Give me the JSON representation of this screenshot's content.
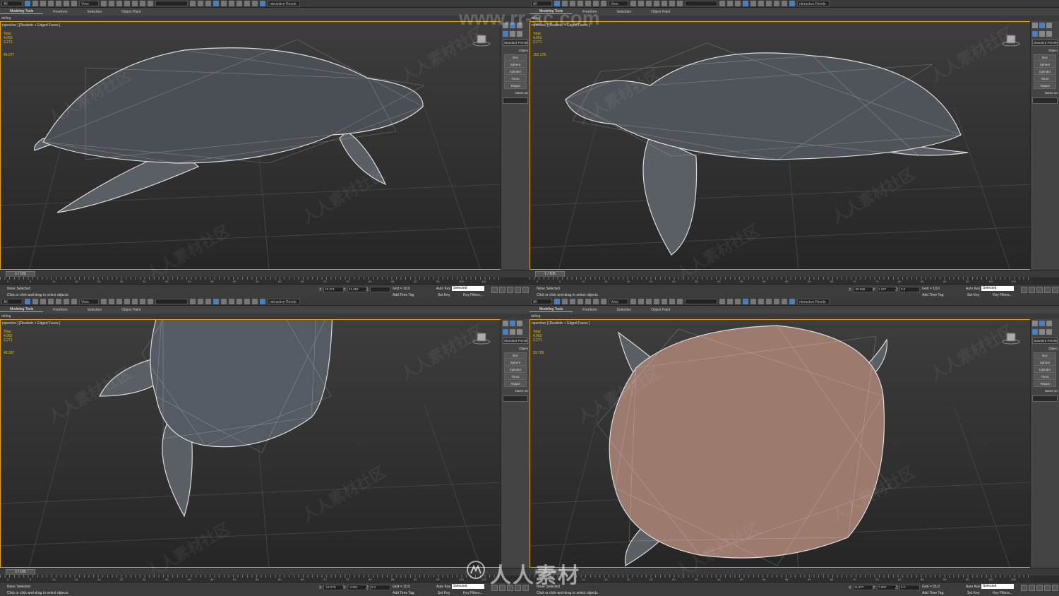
{
  "app": {
    "selection_filter": "All",
    "view_dropdown": "View",
    "interactive_label": "nteractive Rende"
  },
  "ribbon": {
    "tabs": [
      "Modeling Tools",
      "Freeform",
      "Selection",
      "Object Paint"
    ],
    "sub_label": "deling"
  },
  "viewports": [
    {
      "label": "rspective ] [Realistic + Edged Faces ]",
      "stats": [
        "Total",
        "4,052",
        "2,271"
      ],
      "fps": "49.077",
      "time_thumb": "1 / 105",
      "status": [
        "None Selected",
        "Click or click-and-drag to select objects"
      ],
      "coords": {
        "x": "10.371",
        "y": "21.392",
        "z": ""
      },
      "grid": "Grid = 10.0",
      "add_time_tag": "Add Time Tag"
    },
    {
      "label": "rspective ] [Realistic + Edged Faces ]",
      "stats": [
        "Total",
        "4,052",
        "2,271"
      ],
      "fps": "152.178",
      "time_thumb": "1 / 105",
      "status": [
        "None Selected",
        "Click or click-and-drag to select objects"
      ],
      "coords": {
        "x": "-26.846",
        "y": "1.237",
        "z": "0.0"
      },
      "grid": "Grid = 10.0",
      "add_time_tag": "Add Time Tag"
    },
    {
      "label": "rspective ] [Realistic + Edged Faces ]",
      "stats": [
        "Total",
        "4,052",
        "2,271"
      ],
      "fps": "48.287",
      "time_thumb": "1 / 105",
      "status": [
        "None Selected",
        "Click or click-and-drag to select objects"
      ],
      "coords": {
        "x": "-13.279",
        "y": "-3.401",
        "z": "0.0"
      },
      "grid": "Grid = 10.0",
      "add_time_tag": "Add Time Tag"
    },
    {
      "label": "rspective ] [Realistic + Edged Faces ]",
      "stats": [
        "Total",
        "4,052",
        "2,271"
      ],
      "fps": "23.729",
      "time_thumb": "51 / 105",
      "status": [
        "None Selected",
        "Click or click-and-drag to select objects"
      ],
      "coords": {
        "x": "11.877",
        "y": "7.202",
        "z": "0.0"
      },
      "grid": "Grid = 55.0",
      "add_time_tag": "Add Time Tag"
    }
  ],
  "command_panel": {
    "dropdown": "Standard Primitiv",
    "header": "Object",
    "buttons": [
      "Box",
      "Sphere",
      "Cylinder",
      "Torus",
      "Teapot"
    ],
    "name_label": "Name an"
  },
  "anim": {
    "auto_key": "Auto Key",
    "set_key": "Set Key",
    "selected": "Selected",
    "key_filters": "Key Filters..."
  },
  "ruler_ticks": [
    "0",
    "5",
    "10",
    "15",
    "20",
    "25",
    "30",
    "35",
    "40",
    "45",
    "50",
    "55",
    "60",
    "65",
    "70",
    "75",
    "80",
    "85",
    "90",
    "95",
    "100",
    "105"
  ],
  "watermarks": {
    "cn": "人人素材社区",
    "site": "www.rr-sc.com",
    "brand": "人人素材"
  },
  "colors": {
    "viewport_border": "#e0a400",
    "stats_text": "#e6c200",
    "accent_blue": "#4a7fc0"
  }
}
